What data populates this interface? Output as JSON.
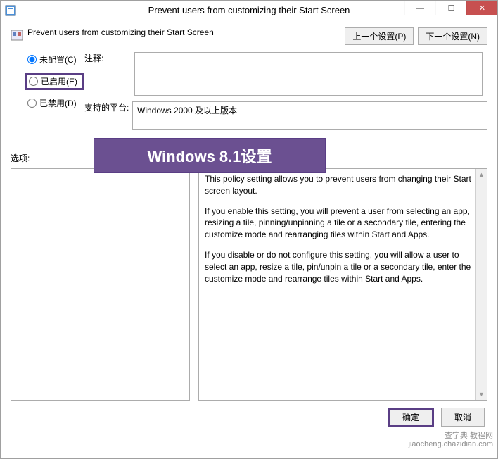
{
  "titlebar": {
    "title": "Prevent users from customizing their Start Screen"
  },
  "policy": {
    "name": "Prevent users from customizing their Start Screen"
  },
  "nav": {
    "prev": "上一个设置(P)",
    "next": "下一个设置(N)"
  },
  "radios": {
    "not_configured": "未配置(C)",
    "enabled": "已启用(E)",
    "disabled": "已禁用(D)"
  },
  "labels": {
    "comment": "注释:",
    "platform": "支持的平台:",
    "options": "选项:"
  },
  "platform": {
    "text": "Windows 2000 及以上版本"
  },
  "overlay": {
    "text": "Windows 8.1设置"
  },
  "help": {
    "p1": "This policy setting allows you to prevent users from changing their Start screen layout.",
    "p2": "If you enable this setting, you will prevent a user from selecting an app, resizing a tile, pinning/unpinning a tile or a secondary tile, entering the customize mode and rearranging tiles within Start and Apps.",
    "p3": "If you disable or do not configure this setting, you will allow a user to select an app, resize a tile, pin/unpin a tile or a secondary tile, enter the customize mode and rearrange tiles within Start and Apps."
  },
  "footer": {
    "ok": "确定",
    "cancel": "取消"
  },
  "watermark": {
    "line1": "查字典 教程网",
    "line2": "jiaocheng.chazidian.com"
  }
}
